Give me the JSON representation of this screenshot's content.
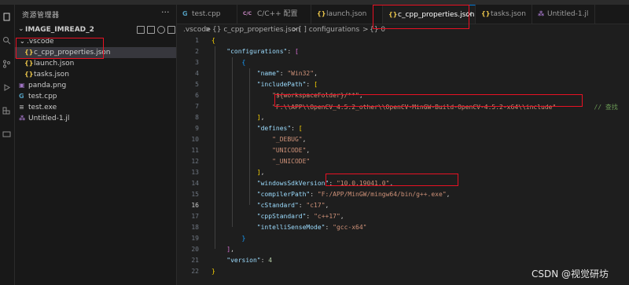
{
  "sidebar": {
    "title": "资源管理器",
    "more": "···",
    "folder": "IMAGE_IMREAD_2",
    "tree": [
      {
        "icon": "⌄",
        "label": ".vscode"
      },
      {
        "icon": "{}",
        "label": "c_cpp_properties.json"
      },
      {
        "icon": "{}",
        "label": "launch.json"
      },
      {
        "icon": "{}",
        "label": "tasks.json"
      },
      {
        "icon": "▣",
        "label": "panda.png"
      },
      {
        "icon": "G",
        "label": "test.cpp"
      },
      {
        "icon": "≡",
        "label": "test.exe"
      },
      {
        "icon": "⁂",
        "label": "Untitled-1.jl"
      }
    ]
  },
  "tabs": [
    {
      "icon": "G",
      "label": "test.cpp"
    },
    {
      "icon": "C/C",
      "label": "C/C++ 配置"
    },
    {
      "icon": "{}",
      "label": "launch.json"
    },
    {
      "icon": "{}",
      "label": "c_cpp_properties.json",
      "close": "×"
    },
    {
      "icon": "{}",
      "label": "tasks.json"
    },
    {
      "icon": "⁂",
      "label": "Untitled-1.jl"
    }
  ],
  "breadcrumb": [
    ".vscode",
    ">",
    "{} c_cpp_properties.json",
    ">",
    "[ ] configurations",
    ">",
    "{} 0"
  ],
  "editor": {
    "line_numbers": [
      "1",
      "2",
      "3",
      "4",
      "5",
      "6",
      "7",
      "8",
      "9",
      "10",
      "11",
      "12",
      "13",
      "14",
      "15",
      "16",
      "17",
      "18",
      "19",
      "20",
      "21",
      "22"
    ],
    "current_line": "16",
    "keys": {
      "configurations": "\"configurations\"",
      "name": "\"name\"",
      "includePath": "\"includePath\"",
      "defines": "\"defines\"",
      "windowsSdkVersion": "\"windowsSdkVersion\"",
      "compilerPath": "\"compilerPath\"",
      "cStandard": "\"cStandard\"",
      "cppStandard": "\"cppStandard\"",
      "intelliSenseMode": "\"intelliSenseMode\"",
      "version": "\"version\""
    },
    "values": {
      "name": "\"Win32\"",
      "include_ws": "\"${workspaceFolder}/**\"",
      "include_opencv": "\"F:\\\\APP\\\\OpenCV_4.5.2_other\\\\OpenCV-MinGW-Build-OpenCV-4.5.2-x64\\\\include\"",
      "trailing_comment": "// 查找",
      "def_debug": "\"_DEBUG\"",
      "def_unicode": "\"UNICODE\"",
      "def_unicode2": "\"_UNICODE\"",
      "sdk": "\"10.0.19041.0\"",
      "compiler": "\"F:/APP/MinGW/mingw64/bin/g++.exe\"",
      "cstd": "\"c17\"",
      "cppstd": "\"c++17\"",
      "intellisense": "\"gcc-x64\"",
      "version": "4"
    }
  },
  "watermark": "CSDN @视觉研坊",
  "colors": {
    "highlight_box": "#e81123",
    "accent": "#0078d4"
  }
}
